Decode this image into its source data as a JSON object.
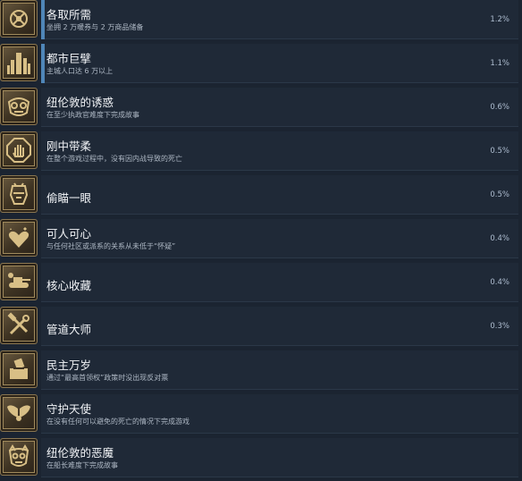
{
  "achievements": [
    {
      "icon": "shackle-icon",
      "title": "各取所需",
      "description": "坐拥 2 万暖券与 2 万商品储备",
      "percent": "1.2%",
      "progress": true
    },
    {
      "icon": "skyscraper-icon",
      "title": "都市巨擘",
      "description": "主城人口达 6 万以上",
      "percent": "1.1%",
      "progress": true
    },
    {
      "icon": "mask-icon",
      "title": "纽伦敦的诱惑",
      "description": "在至少执政官难度下完成故事",
      "percent": "0.6%",
      "progress": false
    },
    {
      "icon": "hand-octagon-icon",
      "title": "刚中带柔",
      "description": "在整个游戏过程中，没有因内战导致的死亡",
      "percent": "0.5%",
      "progress": false
    },
    {
      "icon": "helmet-icon",
      "title": "偷瞄一眼",
      "description": "",
      "percent": "0.5%",
      "progress": false
    },
    {
      "icon": "hearts-icon",
      "title": "可人可心",
      "description": "与任何社区或派系的关系从未低于“怀疑”",
      "percent": "0.4%",
      "progress": false
    },
    {
      "icon": "tank-icon",
      "title": "核心收藏",
      "description": "",
      "percent": "0.4%",
      "progress": false
    },
    {
      "icon": "wrench-hammer-icon",
      "title": "管道大师",
      "description": "",
      "percent": "0.3%",
      "progress": false
    },
    {
      "icon": "ballot-box-icon",
      "title": "民主万岁",
      "description": "通过“最高首领权”政策时没出现反对票",
      "percent": "",
      "progress": false
    },
    {
      "icon": "wings-icon",
      "title": "守护天使",
      "description": "在没有任何可以避免的死亡的情况下完成游戏",
      "percent": "",
      "progress": false
    },
    {
      "icon": "demon-mask-icon",
      "title": "纽伦敦的恶魔",
      "description": "在船长难度下完成故事",
      "percent": "",
      "progress": false
    }
  ],
  "colors": {
    "background": "#1b2431",
    "panel": "#1f2937",
    "progress": "#4f86b8",
    "icon_gold": "#c8a96a"
  }
}
